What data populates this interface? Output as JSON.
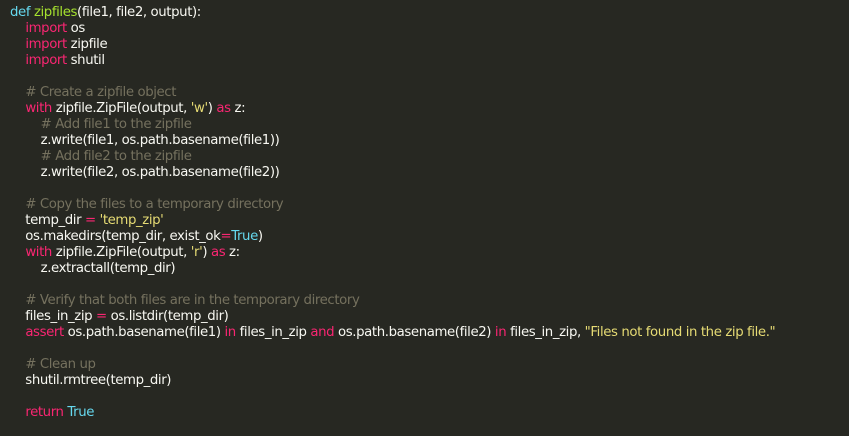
{
  "editor": {
    "theme_colors": {
      "background": "#272822",
      "text": "#f8f8f2",
      "keyword": "#66d9ef",
      "function_name": "#a6e22e",
      "comment": "#75715e",
      "string": "#e6db74",
      "operator": "#f92672"
    },
    "lines": [
      [
        [
          "kw",
          "def"
        ],
        [
          "pl",
          " "
        ],
        [
          "fn",
          "zipfiles"
        ],
        [
          "pl",
          "(file1, file2, output):"
        ]
      ],
      [
        [
          "pl",
          "    "
        ],
        [
          "op",
          "import"
        ],
        [
          "pl",
          " os"
        ]
      ],
      [
        [
          "pl",
          "    "
        ],
        [
          "op",
          "import"
        ],
        [
          "pl",
          " zipfile"
        ]
      ],
      [
        [
          "pl",
          "    "
        ],
        [
          "op",
          "import"
        ],
        [
          "pl",
          " shutil"
        ]
      ],
      [],
      [
        [
          "pl",
          "    "
        ],
        [
          "cm",
          "# Create a zipfile object"
        ]
      ],
      [
        [
          "pl",
          "    "
        ],
        [
          "op",
          "with"
        ],
        [
          "pl",
          " zipfile.ZipFile(output, "
        ],
        [
          "st",
          "'w'"
        ],
        [
          "pl",
          ") "
        ],
        [
          "op",
          "as"
        ],
        [
          "pl",
          " z:"
        ]
      ],
      [
        [
          "pl",
          "        "
        ],
        [
          "cm",
          "# Add file1 to the zipfile"
        ]
      ],
      [
        [
          "pl",
          "        z.write(file1, os.path.basename(file1))"
        ]
      ],
      [
        [
          "pl",
          "        "
        ],
        [
          "cm",
          "# Add file2 to the zipfile"
        ]
      ],
      [
        [
          "pl",
          "        z.write(file2, os.path.basename(file2))"
        ]
      ],
      [],
      [
        [
          "pl",
          "    "
        ],
        [
          "cm",
          "# Copy the files to a temporary directory"
        ]
      ],
      [
        [
          "pl",
          "    temp_dir "
        ],
        [
          "op",
          "="
        ],
        [
          "pl",
          " "
        ],
        [
          "st",
          "'temp_zip'"
        ]
      ],
      [
        [
          "pl",
          "    os.makedirs(temp_dir, exist_ok"
        ],
        [
          "op",
          "="
        ],
        [
          "kw",
          "True"
        ],
        [
          "pl",
          ")"
        ]
      ],
      [
        [
          "pl",
          "    "
        ],
        [
          "op",
          "with"
        ],
        [
          "pl",
          " zipfile.ZipFile(output, "
        ],
        [
          "st",
          "'r'"
        ],
        [
          "pl",
          ") "
        ],
        [
          "op",
          "as"
        ],
        [
          "pl",
          " z:"
        ]
      ],
      [
        [
          "pl",
          "        z.extractall(temp_dir)"
        ]
      ],
      [],
      [
        [
          "pl",
          "    "
        ],
        [
          "cm",
          "# Verify that both files are in the temporary directory"
        ]
      ],
      [
        [
          "pl",
          "    files_in_zip "
        ],
        [
          "op",
          "="
        ],
        [
          "pl",
          " os.listdir(temp_dir)"
        ]
      ],
      [
        [
          "pl",
          "    "
        ],
        [
          "op",
          "assert"
        ],
        [
          "pl",
          " os.path.basename(file1) "
        ],
        [
          "op",
          "in"
        ],
        [
          "pl",
          " files_in_zip "
        ],
        [
          "op",
          "and"
        ],
        [
          "pl",
          " os.path.basename(file2) "
        ],
        [
          "op",
          "in"
        ],
        [
          "pl",
          " files_in_zip, "
        ],
        [
          "st",
          "\"Files not found in the zip file.\""
        ]
      ],
      [],
      [
        [
          "pl",
          "    "
        ],
        [
          "cm",
          "# Clean up"
        ]
      ],
      [
        [
          "pl",
          "    shutil.rmtree(temp_dir)"
        ]
      ],
      [],
      [
        [
          "pl",
          "    "
        ],
        [
          "op",
          "return"
        ],
        [
          "pl",
          " "
        ],
        [
          "kw",
          "True"
        ]
      ]
    ]
  }
}
